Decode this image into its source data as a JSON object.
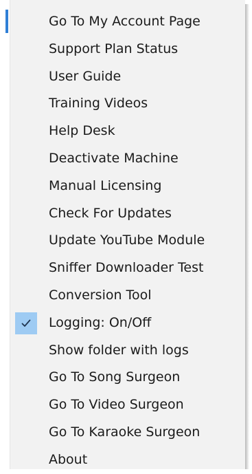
{
  "menu": {
    "items": [
      {
        "label": "Go To My Account Page",
        "checked": false
      },
      {
        "label": "Support Plan Status",
        "checked": false
      },
      {
        "label": "User Guide",
        "checked": false
      },
      {
        "label": "Training Videos",
        "checked": false
      },
      {
        "label": "Help Desk",
        "checked": false
      },
      {
        "label": "Deactivate Machine",
        "checked": false
      },
      {
        "label": "Manual Licensing",
        "checked": false
      },
      {
        "label": "Check For Updates",
        "checked": false
      },
      {
        "label": "Update YouTube Module",
        "checked": false
      },
      {
        "label": "Sniffer Downloader Test",
        "checked": false
      },
      {
        "label": "Conversion Tool",
        "checked": false
      },
      {
        "label": "Logging: On/Off",
        "checked": true
      },
      {
        "label": "Show folder with logs",
        "checked": false
      },
      {
        "label": "Go To Song Surgeon",
        "checked": false
      },
      {
        "label": "Go To Video Surgeon",
        "checked": false
      },
      {
        "label": "Go To Karaoke Surgeon",
        "checked": false
      },
      {
        "label": "About",
        "checked": false
      }
    ]
  },
  "colors": {
    "menu_background": "#f2f2f2",
    "check_highlight": "#9ecbf3",
    "text": "#1a1a1a"
  }
}
